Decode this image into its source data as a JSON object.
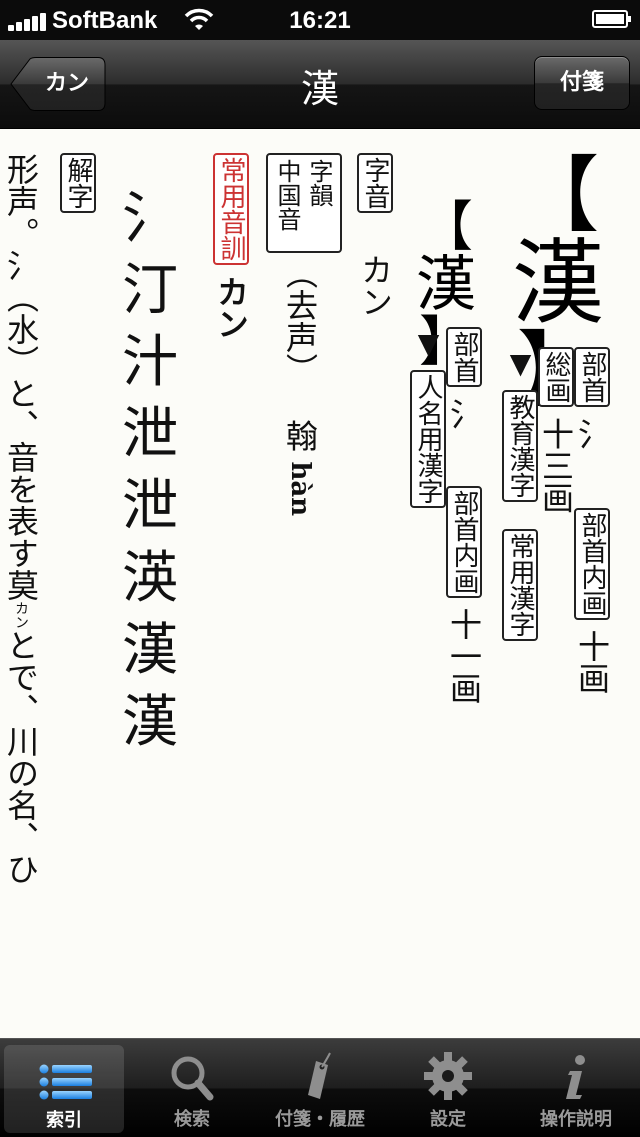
{
  "status_bar": {
    "carrier": "SoftBank",
    "time": "16:21"
  },
  "nav": {
    "back_label": "カン",
    "title": "漢",
    "right_button": "付箋"
  },
  "entry": {
    "headword_main": "漢",
    "headword_alt": "漢",
    "col1": {
      "tag_bushu": "部首",
      "bushu": "氵",
      "tag_bushunaikaku": "部首内画",
      "bushunaikaku": "十画"
    },
    "col2": {
      "tag_soukaku": "総画",
      "soukaku": "十三画",
      "tag_kyouiku": "教育漢字",
      "tag_jouyou": "常用漢字"
    },
    "col3": {
      "tag_bushu": "部首",
      "bushu": "氵",
      "tag_bushunaikaku": "部首内画",
      "bushunaikaku": "十一画"
    },
    "col4": {
      "tag_jinmei": "人名用漢字"
    },
    "jion": {
      "tag": "字音",
      "value": "カン"
    },
    "chugoku": {
      "tag_line1": "字韻",
      "tag_line2": "中国音",
      "shisei": "（去声）",
      "inyun": "翰",
      "pinyin": "hàn"
    },
    "jouyou_onkun": {
      "tag": "常用音訓",
      "value": "カン"
    },
    "stroke_order": [
      "氵",
      "汀",
      "汁",
      "泄",
      "泄",
      "渶",
      "漢",
      "漢"
    ],
    "kaiji": {
      "tag": "解字",
      "text_before": "形声。氵（水）と、音を表す",
      "phonetic": "莫",
      "ruby": "カン",
      "text_after": "とで、川の名、ひ"
    }
  },
  "tabbar": {
    "items": [
      {
        "label": "索引",
        "icon": "list-icon"
      },
      {
        "label": "検索",
        "icon": "search-icon"
      },
      {
        "label": "付箋・履歴",
        "icon": "tag-icon"
      },
      {
        "label": "設定",
        "icon": "gear-icon"
      },
      {
        "label": "操作説明",
        "icon": "info-icon"
      }
    ]
  }
}
